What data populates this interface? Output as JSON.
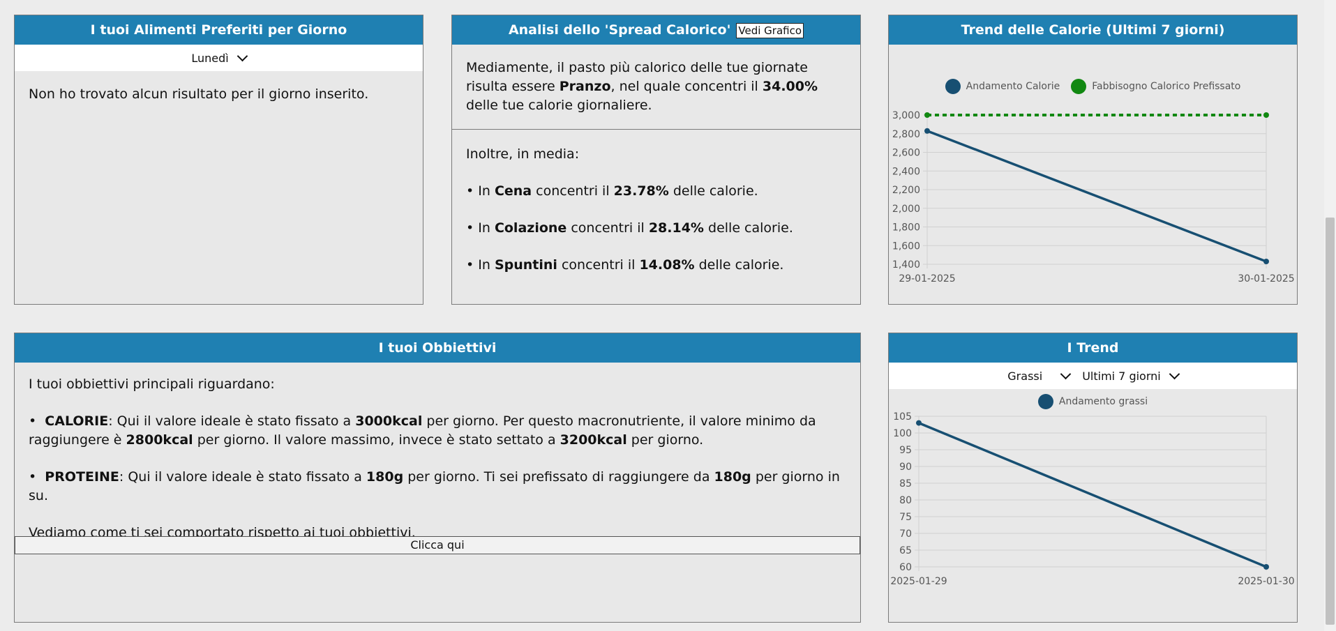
{
  "favorites": {
    "title": "I tuoi Alimenti Preferiti per Giorno",
    "day_selected": "Lunedì",
    "message": "Non ho trovato alcun risultato per il giorno inserito."
  },
  "spread": {
    "title": "Analisi dello 'Spread Calorico'",
    "chart_button": "Vedi Grafico",
    "p1_a": "Mediamente, il pasto più calorico delle tue giornate risulta essere ",
    "p1_meal": "Pranzo",
    "p1_b": ", nel quale concentri il ",
    "p1_pct": "34.00%",
    "p1_c": " delle tue calorie giornaliere.",
    "intro": "Inoltre, in media:",
    "items": [
      {
        "meal": "Cena",
        "pct": "23.78%"
      },
      {
        "meal": "Colazione",
        "pct": "28.14%"
      },
      {
        "meal": "Spuntini",
        "pct": "14.08%"
      }
    ],
    "item_prefix": "• In ",
    "item_mid": " concentri il ",
    "item_suffix": " delle calorie."
  },
  "trend_calories": {
    "title": "Trend delle Calorie (Ultimi 7 giorni)",
    "colors": {
      "series": "#174f72",
      "target": "#118811"
    }
  },
  "goals": {
    "title": "I tuoi Obbiettivi",
    "intro": "I tuoi obbiettivi principali riguardano:",
    "cal_label": "CALORIE",
    "cal_a": ": Qui il valore ideale è stato fissato a ",
    "cal_ideal": "3000kcal",
    "cal_b": " per giorno. Per questo macronutriente, il valore minimo da raggiungere è ",
    "cal_min": "2800kcal",
    "cal_c": " per giorno. Il valore massimo, invece è stato settato a ",
    "cal_max": "3200kcal",
    "cal_d": " per giorno.",
    "prot_label": "PROTEINE",
    "prot_a": ": Qui il valore ideale è stato fissato a ",
    "prot_ideal": "180g",
    "prot_b": " per giorno. Ti sei prefissato di raggiungere da ",
    "prot_min": "180g",
    "prot_c": " per giorno in su.",
    "closing": "Vediamo come ti sei comportato rispetto ai tuoi obbiettivi.",
    "button": "Clicca qui"
  },
  "trend": {
    "title": "I Trend",
    "macro_selected": "Grassi",
    "period_selected": "Ultimi 7 giorni"
  },
  "chart_data": [
    {
      "type": "line",
      "title": "Trend delle Calorie (Ultimi 7 giorni)",
      "x": [
        "29-01-2025",
        "30-01-2025"
      ],
      "series": [
        {
          "name": "Andamento Calorie",
          "values": [
            2830,
            1430
          ]
        },
        {
          "name": "Fabbisogno Calorico Prefissato",
          "values": [
            3000,
            3000
          ],
          "style": "dashed"
        }
      ],
      "ylim": [
        1400,
        3000
      ],
      "yticks": [
        "3,000",
        "2,800",
        "2,600",
        "2,400",
        "2,200",
        "2,000",
        "1,800",
        "1,600",
        "1,400"
      ],
      "legend": "top",
      "grid": true
    },
    {
      "type": "line",
      "title": "",
      "x": [
        "2025-01-29",
        "2025-01-30"
      ],
      "series": [
        {
          "name": "Andamento grassi",
          "values": [
            103,
            60
          ]
        }
      ],
      "ylim": [
        60,
        105
      ],
      "yticks": [
        "105",
        "100",
        "95",
        "90",
        "85",
        "80",
        "75",
        "70",
        "65",
        "60"
      ],
      "legend": "top",
      "grid": true
    }
  ]
}
